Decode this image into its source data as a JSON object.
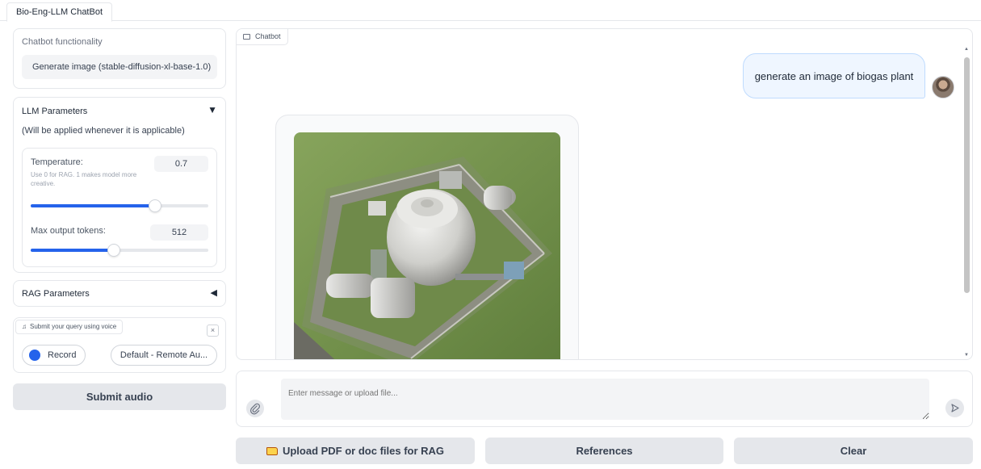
{
  "tabs": [
    {
      "label": "Bio-Eng-LLM ChatBot"
    }
  ],
  "functionality": {
    "label": "Chatbot functionality",
    "selected": "Generate image (stable-diffusion-xl-base-1.0)"
  },
  "llm_params": {
    "title": "LLM Parameters",
    "arrow": "▼",
    "note": "(Will be applied whenever it is applicable)",
    "temperature": {
      "label": "Temperature:",
      "info": "Use 0 for RAG. 1 makes model more creative.",
      "value": "0.7",
      "slider_fraction": 0.7
    },
    "max_tokens": {
      "label": "Max output tokens:",
      "value": "512",
      "slider_fraction": 0.47
    }
  },
  "rag_params": {
    "title": "RAG Parameters",
    "arrow": "◀"
  },
  "voice": {
    "label": "Submit your query using voice",
    "close": "×",
    "record_label": "Record",
    "device_label": "Default - Remote Au..."
  },
  "submit_audio_label": "Submit audio",
  "chat": {
    "label": "Chatbot",
    "messages": [
      {
        "role": "user",
        "text": "generate an image of biogas plant"
      },
      {
        "role": "bot",
        "content": "generated image"
      }
    ]
  },
  "input": {
    "placeholder": "Enter message or upload file..."
  },
  "buttons": {
    "upload": "Upload PDF or doc files for RAG",
    "references": "References",
    "clear": "Clear"
  },
  "colors": {
    "accent": "#2563eb",
    "button_bg": "#e5e7eb",
    "user_bubble": "#eff6ff"
  },
  "icons": [
    "music-note-icon",
    "close-icon",
    "record-dot-icon",
    "chat-icon",
    "paperclip-icon",
    "send-icon",
    "folder-icon"
  ]
}
